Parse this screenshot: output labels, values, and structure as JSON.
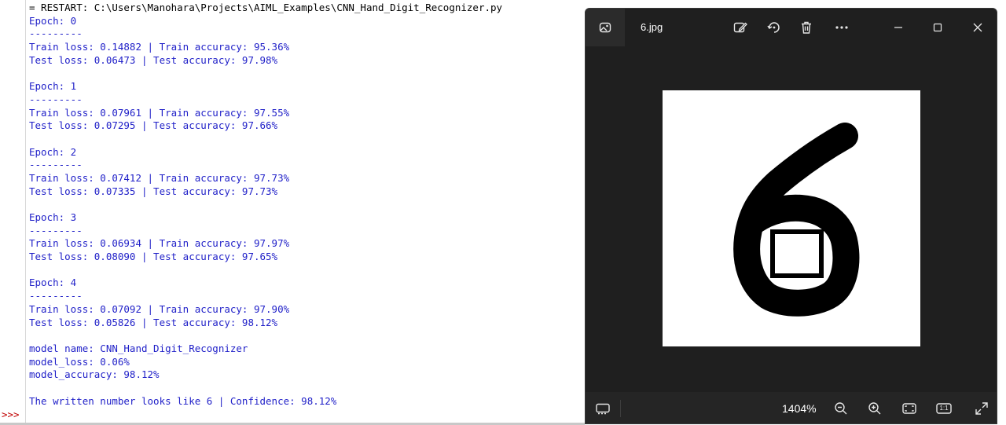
{
  "shell": {
    "prompt": ">>>",
    "lines": [
      {
        "text": "= RESTART: C:\\Users\\Manohara\\Projects\\AIML_Examples\\CNN_Hand_Digit_Recognizer.py",
        "color": "#000000"
      },
      {
        "text": "Epoch: 0",
        "color": "#1f1fc8"
      },
      {
        "text": "---------",
        "color": "#1f1fc8"
      },
      {
        "text": "Train loss: 0.14882 | Train accuracy: 95.36%",
        "color": "#1f1fc8"
      },
      {
        "text": "Test loss: 0.06473 | Test accuracy: 97.98%",
        "color": "#1f1fc8"
      },
      {
        "text": "",
        "color": "#1f1fc8"
      },
      {
        "text": "Epoch: 1",
        "color": "#1f1fc8"
      },
      {
        "text": "---------",
        "color": "#1f1fc8"
      },
      {
        "text": "Train loss: 0.07961 | Train accuracy: 97.55%",
        "color": "#1f1fc8"
      },
      {
        "text": "Test loss: 0.07295 | Test accuracy: 97.66%",
        "color": "#1f1fc8"
      },
      {
        "text": "",
        "color": "#1f1fc8"
      },
      {
        "text": "Epoch: 2",
        "color": "#1f1fc8"
      },
      {
        "text": "---------",
        "color": "#1f1fc8"
      },
      {
        "text": "Train loss: 0.07412 | Train accuracy: 97.73%",
        "color": "#1f1fc8"
      },
      {
        "text": "Test loss: 0.07335 | Test accuracy: 97.73%",
        "color": "#1f1fc8"
      },
      {
        "text": "",
        "color": "#1f1fc8"
      },
      {
        "text": "Epoch: 3",
        "color": "#1f1fc8"
      },
      {
        "text": "---------",
        "color": "#1f1fc8"
      },
      {
        "text": "Train loss: 0.06934 | Train accuracy: 97.97%",
        "color": "#1f1fc8"
      },
      {
        "text": "Test loss: 0.08090 | Test accuracy: 97.65%",
        "color": "#1f1fc8"
      },
      {
        "text": "",
        "color": "#1f1fc8"
      },
      {
        "text": "Epoch: 4",
        "color": "#1f1fc8"
      },
      {
        "text": "---------",
        "color": "#1f1fc8"
      },
      {
        "text": "Train loss: 0.07092 | Train accuracy: 97.90%",
        "color": "#1f1fc8"
      },
      {
        "text": "Test loss: 0.05826 | Test accuracy: 98.12%",
        "color": "#1f1fc8"
      },
      {
        "text": "",
        "color": "#1f1fc8"
      },
      {
        "text": "model name: CNN_Hand_Digit_Recognizer",
        "color": "#1f1fc8"
      },
      {
        "text": "model_loss: 0.06%",
        "color": "#1f1fc8"
      },
      {
        "text": "model_accuracy: 98.12%",
        "color": "#1f1fc8"
      },
      {
        "text": "",
        "color": "#1f1fc8"
      },
      {
        "text": "The written number looks like 6 | Confidence: 98.12%",
        "color": "#1f1fc8"
      }
    ]
  },
  "viewer": {
    "filename": "6.jpg",
    "zoom": "1404%",
    "title_icons": [
      "gallery-icon",
      "edit-image-icon",
      "rotate-icon",
      "delete-icon",
      "more-icon",
      "minimize-icon",
      "maximize-icon",
      "close-icon"
    ],
    "bottom_icons": [
      "filmstrip-icon",
      "zoom-out-icon",
      "zoom-in-icon",
      "fit-to-window-icon",
      "actual-size-icon",
      "fullscreen-icon"
    ],
    "actual_size_label": "1:1"
  }
}
